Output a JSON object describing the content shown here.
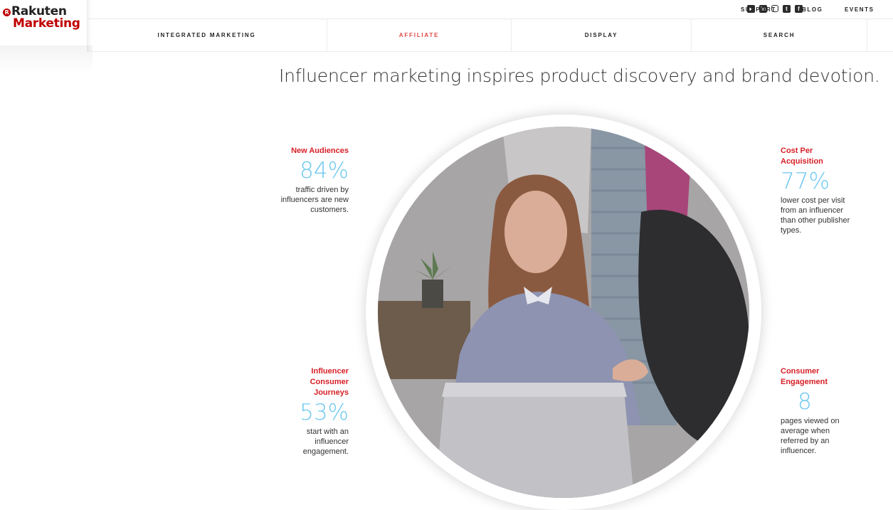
{
  "brand": {
    "line1": "Rakuten",
    "line2": "Marketing",
    "mark": "R"
  },
  "social_icons": [
    "youtube-icon",
    "linkedin-icon",
    "instagram-icon",
    "twitter-icon",
    "facebook-icon"
  ],
  "utility_nav": [
    "SUPPORT",
    "BLOG",
    "EVENTS"
  ],
  "main_nav": [
    {
      "label": "INTEGRATED MARKETING",
      "active": false
    },
    {
      "label": "AFFILIATE",
      "active": true
    },
    {
      "label": "DISPLAY",
      "active": false
    },
    {
      "label": "SEARCH",
      "active": false
    }
  ],
  "headline": "Influencer marketing inspires product discovery and brand devotion.",
  "stats": [
    {
      "title": "New Audiences",
      "value": "84%",
      "desc": "traffic driven by influencers are new customers."
    },
    {
      "title": "Cost Per Acquisition",
      "value": "77%",
      "desc": "lower cost per visit from an influencer than other publisher types."
    },
    {
      "title": "Influencer Consumer Journeys",
      "value": "53%",
      "desc": "start with an influencer engagement."
    },
    {
      "title": "Consumer Engagement",
      "value": "8",
      "desc": "pages viewed on average when referred by an influencer."
    }
  ],
  "colors": {
    "brand_red": "#bf0000",
    "accent_red": "#d62027",
    "active_nav": "#e24a45",
    "stat_blue": "#6ec8ee"
  }
}
